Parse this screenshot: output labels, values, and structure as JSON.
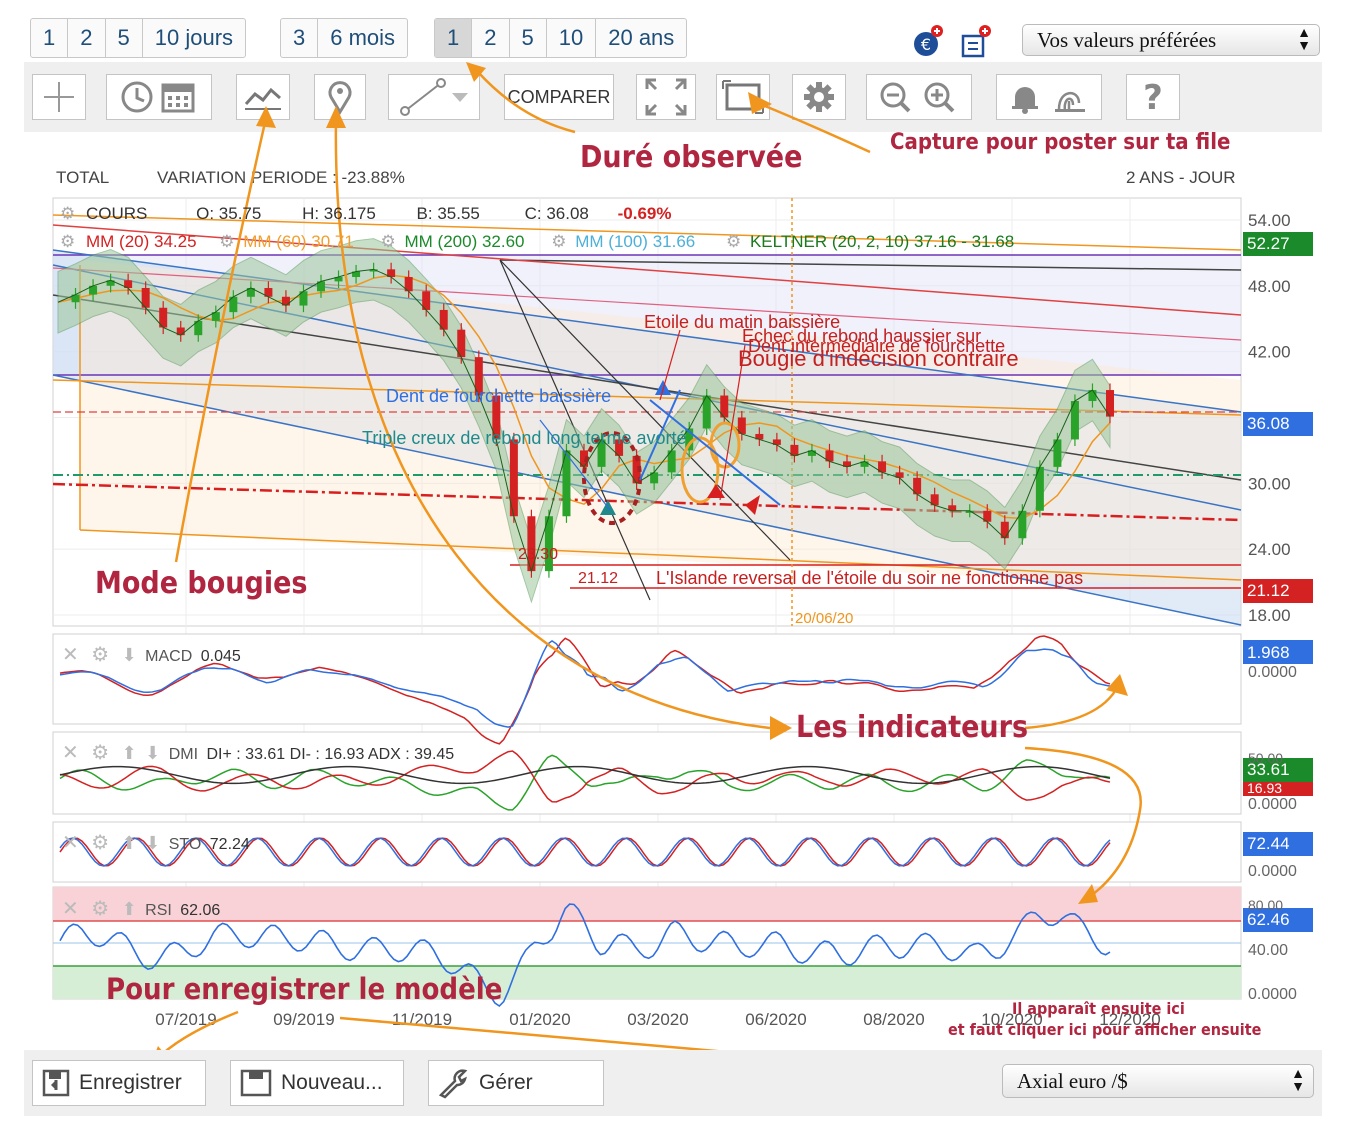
{
  "period_buttons": {
    "short": [
      "1",
      "2",
      "5",
      "10 jours"
    ],
    "medium": [
      "3",
      "6 mois"
    ],
    "long": [
      "1",
      "2",
      "5",
      "10",
      "20 ans"
    ],
    "selected_long": "1"
  },
  "favorites_select": "Vos valeurs préférées",
  "toolbar": {
    "compare_label": "COMPARER",
    "icons": [
      "crosshair-icon",
      "clock-icon",
      "calendar-icon",
      "line-mode-icon",
      "marker-pin-icon",
      "trendline-icon",
      "dropdown-icon",
      "fullscreen-icon",
      "capture-icon",
      "settings-gear-icon",
      "zoom-out-icon",
      "zoom-in-icon",
      "alert-bell-icon",
      "fingerprint-icon",
      "help-icon"
    ]
  },
  "header": {
    "total": "TOTAL",
    "variation": "VARIATION PERIODE : -23.88%",
    "scale": "2 ANS - JOUR"
  },
  "legend": {
    "cours": "COURS",
    "open": "O: 35.75",
    "high": "H: 36.175",
    "low": "B: 35.55",
    "close": "C: 36.08",
    "change": "-0.69%",
    "mm20": "MM (20) 34.25",
    "mm60": "MM (60) 30.71",
    "mm200": "MM (200) 32.60",
    "mm100": "MM (100) 31.66",
    "keltner": "KELTNER (20, 2, 10) 37.16 - 31.68"
  },
  "panels": {
    "macd": {
      "label": "MACD",
      "value": "0.045",
      "badge": "1.968",
      "zero": "0.0000"
    },
    "dmi": {
      "label": "DMI",
      "value": "DI+ : 33.61 DI- : 16.93 ADX : 39.45",
      "badge_plus": "33.61",
      "badge_minus": "16.93",
      "top": "50.00",
      "zero": "0.0000"
    },
    "sto": {
      "label": "STO",
      "value": "72.24",
      "badge": "72.44",
      "zero": "0.0000"
    },
    "rsi": {
      "label": "RSI",
      "value": "62.06",
      "badge": "62.46",
      "top": "80.00",
      "mid": "40.00",
      "zero": "0.0000"
    }
  },
  "price_badges": {
    "upper": "52.27",
    "current": "36.08",
    "lower": "21.12"
  },
  "chart_annotations": {
    "morning_star": "Etoile du matin baissière",
    "rebound_failure": "Echec du rebond haussier sur",
    "intermediate_tooth": "Dent intermédiaire de fourchette",
    "indecision": "Bougie d'indécision contraire",
    "bearish_tooth": "Dent de fourchette baissière",
    "triple_trough": "Triple creux de rebond long terme avorté",
    "island": "L'Islande reversal de l'étoile du soir ne fonctionne pas",
    "level_2330": "23.30",
    "level_2112": "21.12",
    "date_marker": "20/06/20"
  },
  "callouts": {
    "duration": "Duré observée",
    "capture": "Capture pour poster sur ta file",
    "candles": "Mode bougies",
    "indicators": "Les  indicateurs",
    "save_model": "Pour enregistrer le modèle",
    "appears_here": "Il apparaît ensuite ici",
    "click_here": "et faut cliquer ici pour afficher ensuite"
  },
  "bottom": {
    "save": "Enregistrer",
    "new": "Nouveau...",
    "manage": "Gérer",
    "model_select": "Axial euro /$"
  },
  "colors": {
    "accent_blue": "#1f4e79",
    "annotation_red": "#b0253f",
    "orange_arrow": "#f0961e",
    "badge_blue": "#2f6fe0",
    "badge_green": "#1b8a2a",
    "badge_red": "#d42121"
  },
  "chart_data": {
    "type": "line",
    "title": "",
    "x_ticks": [
      "07/2019",
      "09/2019",
      "11/2019",
      "01/2020",
      "03/2020",
      "06/2020",
      "08/2020",
      "10/2020",
      "12/2020"
    ],
    "y_ticks": [
      54.0,
      48.0,
      42.0,
      36.0,
      30.0,
      24.0,
      18.0
    ],
    "ylim": [
      17,
      56
    ],
    "series": [
      {
        "name": "COURS",
        "values": [
          46.5,
          47.2,
          48.0,
          48.5,
          47.8,
          46.0,
          44.2,
          43.5,
          44.8,
          45.6,
          47.0,
          47.8,
          47.0,
          46.2,
          47.5,
          48.4,
          48.8,
          49.3,
          49.5,
          48.8,
          47.5,
          45.8,
          44.0,
          41.5,
          38.0,
          34.0,
          27.0,
          22.0,
          27.0,
          33.0,
          31.5,
          34.0,
          32.5,
          30.0,
          31.0,
          33.0,
          35.0,
          38.0,
          36.0,
          34.5,
          34.0,
          33.5,
          32.5,
          33.0,
          32.0,
          31.5,
          32.0,
          31.0,
          30.5,
          29.0,
          28.0,
          27.5,
          27.5,
          26.5,
          25.0,
          27.5,
          31.5,
          34.0,
          37.5,
          38.5,
          36.08
        ]
      }
    ]
  }
}
